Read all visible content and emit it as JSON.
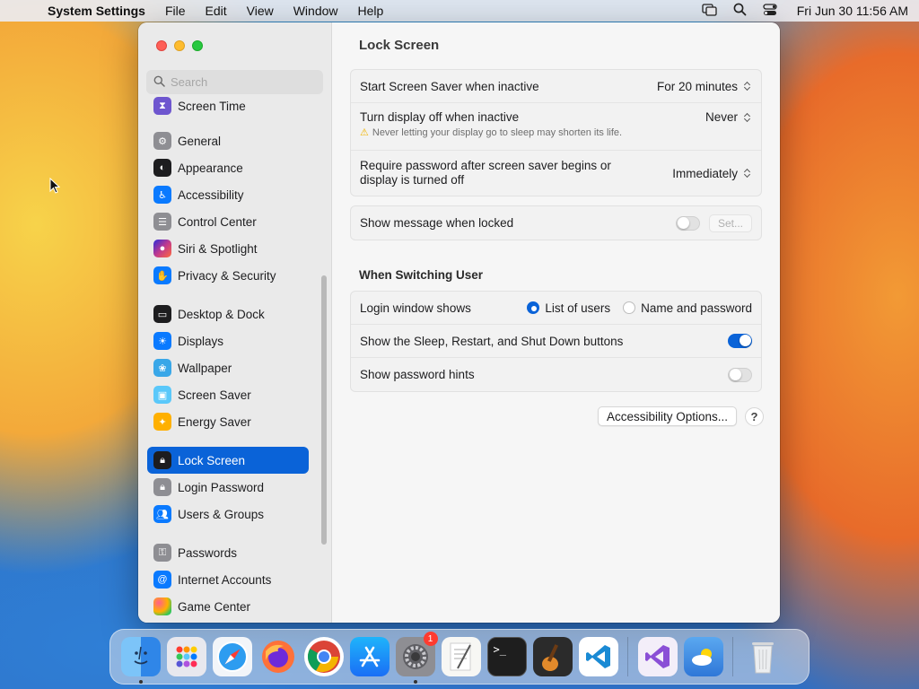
{
  "menubar": {
    "app_name": "System Settings",
    "menus": [
      "File",
      "Edit",
      "View",
      "Window",
      "Help"
    ],
    "clock": "Fri Jun 30  11:56 AM"
  },
  "sidebar": {
    "search_placeholder": "Search",
    "items": [
      {
        "label": "Screen Time",
        "icon": "hourglass-icon",
        "color": "#6e56cf"
      },
      {
        "label": "General",
        "icon": "gear-icon",
        "color": "#8e8e93"
      },
      {
        "label": "Appearance",
        "icon": "appearance-icon",
        "color": "#1d1d1f"
      },
      {
        "label": "Accessibility",
        "icon": "accessibility-icon",
        "color": "#0a7aff"
      },
      {
        "label": "Control Center",
        "icon": "control-center-icon",
        "color": "#8e8e93"
      },
      {
        "label": "Siri & Spotlight",
        "icon": "siri-icon",
        "color": "#c0398f"
      },
      {
        "label": "Privacy & Security",
        "icon": "hand-icon",
        "color": "#0a7aff"
      },
      {
        "label": "Desktop & Dock",
        "icon": "desktop-dock-icon",
        "color": "#1d1d1f"
      },
      {
        "label": "Displays",
        "icon": "sun-icon",
        "color": "#0a7aff"
      },
      {
        "label": "Wallpaper",
        "icon": "wallpaper-icon",
        "color": "#39a7e8"
      },
      {
        "label": "Screen Saver",
        "icon": "screen-saver-icon",
        "color": "#5ac8fa"
      },
      {
        "label": "Energy Saver",
        "icon": "lightbulb-icon",
        "color": "#ffb000"
      },
      {
        "label": "Lock Screen",
        "icon": "lock-icon",
        "color": "#1d1d1f",
        "active": true
      },
      {
        "label": "Login Password",
        "icon": "lock-icon",
        "color": "#8e8e93"
      },
      {
        "label": "Users & Groups",
        "icon": "users-icon",
        "color": "#0a7aff"
      },
      {
        "label": "Passwords",
        "icon": "key-icon",
        "color": "#8e8e93"
      },
      {
        "label": "Internet Accounts",
        "icon": "at-icon",
        "color": "#0a7aff"
      },
      {
        "label": "Game Center",
        "icon": "game-center-icon",
        "color": "#ff9500"
      }
    ]
  },
  "content": {
    "title": "Lock Screen",
    "rows": {
      "screen_saver": {
        "label": "Start Screen Saver when inactive",
        "value": "For 20 minutes"
      },
      "display_off": {
        "label": "Turn display off when inactive",
        "value": "Never",
        "warning": "Never letting your display go to sleep may shorten its life."
      },
      "require_password": {
        "label_line1": "Require password after screen saver begins or",
        "label_line2": "display is turned off",
        "value": "Immediately"
      },
      "show_message": {
        "label": "Show message when locked",
        "toggle": false,
        "button": "Set..."
      }
    },
    "switching": {
      "title": "When Switching User",
      "login_window": {
        "label": "Login window shows",
        "options": [
          "List of users",
          "Name and password"
        ],
        "selected": "List of users"
      },
      "sleep_buttons": {
        "label": "Show the Sleep, Restart, and Shut Down buttons",
        "toggle": true
      },
      "password_hints": {
        "label": "Show password hints",
        "toggle": false
      }
    },
    "accessibility_button": "Accessibility Options...",
    "help_button": "?"
  },
  "dock": {
    "apps": [
      {
        "name": "Finder",
        "icon": "finder-icon",
        "color": "#3a8ef0",
        "running": true
      },
      {
        "name": "Launchpad",
        "icon": "launchpad-icon",
        "color": "#e8e8ee"
      },
      {
        "name": "Safari",
        "icon": "safari-icon",
        "color": "#e9f2fc"
      },
      {
        "name": "Firefox",
        "icon": "firefox-icon",
        "color": "#ff7139"
      },
      {
        "name": "Chrome",
        "icon": "chrome-icon",
        "color": "#ffffff"
      },
      {
        "name": "App Store",
        "icon": "app-store-icon",
        "color": "#1a8cf5"
      },
      {
        "name": "System Settings",
        "icon": "system-settings-icon",
        "color": "#8e8e93",
        "running": true,
        "badge": "1"
      },
      {
        "name": "TextEdit",
        "icon": "textedit-icon",
        "color": "#f4f4f4"
      },
      {
        "name": "Terminal",
        "icon": "terminal-icon",
        "color": "#1e1e1e"
      },
      {
        "name": "GarageBand",
        "icon": "garageband-icon",
        "color": "#2b2b2b"
      },
      {
        "name": "VS Code",
        "icon": "vscode-icon",
        "color": "#ffffff"
      },
      {
        "name": "Visual Studio",
        "icon": "visual-studio-icon",
        "color": "#f3eef9"
      },
      {
        "name": "Weather",
        "icon": "weather-icon",
        "color": "#3f8ee8"
      },
      {
        "name": "Trash",
        "icon": "trash-icon",
        "color": "#e6e8ea"
      }
    ]
  }
}
